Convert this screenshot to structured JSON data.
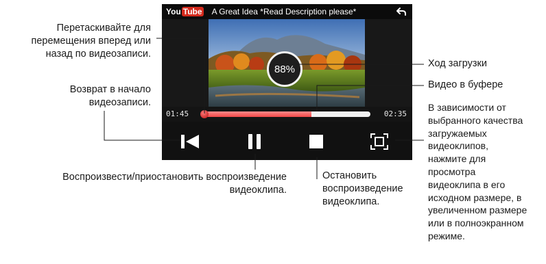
{
  "player": {
    "logo_you": "You",
    "logo_tube": "Tube",
    "video_title": "A Great Idea *Read Description please*",
    "download_progress": "88%",
    "time_elapsed": "01:45",
    "time_total": "02:35",
    "buffered_fraction": 0.65,
    "playhead_fraction": 0.0
  },
  "icons": {
    "back": "back-arrow-icon",
    "rewind": "skip-to-start-icon",
    "pause": "pause-icon",
    "stop": "stop-icon",
    "fullscreen": "fullscreen-icon"
  },
  "annotations": {
    "drag": [
      "Перетаскивайте для",
      "перемещения вперед или",
      "назад по видеозаписи."
    ],
    "restart": [
      "Возврат в начало",
      "видеозаписи."
    ],
    "play_pause": [
      "Воспроизвести/приостановить воспроизведение",
      "видеоклипа."
    ],
    "stop": [
      "Остановить",
      "воспроизведение",
      "видеоклипа."
    ],
    "download_progress": [
      "Ход загрузки"
    ],
    "buffered": [
      "Видео в буфере"
    ],
    "fullscreen": [
      "В зависимости от",
      "выбранного качества",
      "загружаемых",
      "видеоклипов,",
      "нажмите для",
      "просмотра",
      "видеоклипа в его",
      "исходном размере, в",
      "увеличенном размере",
      "или в полноэкранном",
      "режиме."
    ]
  }
}
